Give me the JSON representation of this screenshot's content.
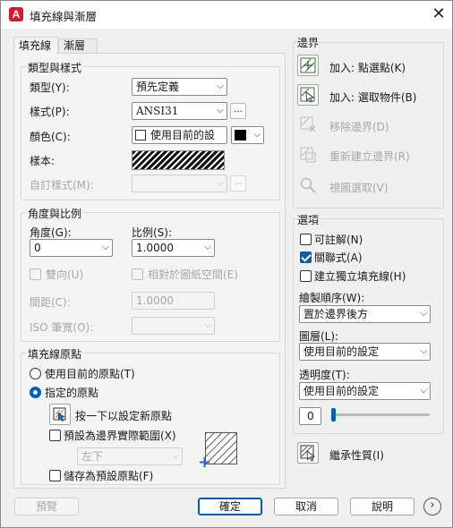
{
  "window": {
    "title": "填充線與漸層"
  },
  "tabs": [
    {
      "label": "填充線"
    },
    {
      "label": "漸層"
    }
  ],
  "type_pattern": {
    "group_title": "類型與樣式",
    "type_label": "類型(Y):",
    "type_value": "預先定義",
    "pattern_label": "樣式(P):",
    "pattern_value": "ANSI31",
    "color_label": "顏色(C):",
    "color_value": "使用目前的設",
    "swatch_label": "樣本:",
    "custom_label": "自訂樣式(M):",
    "ellipsis": "..."
  },
  "angle_scale": {
    "group_title": "角度與比例",
    "angle_label": "角度(G):",
    "angle_value": "0",
    "scale_label": "比例(S):",
    "scale_value": "1.0000",
    "double_label": "雙向(U)",
    "relative_label": "相對於圖紙空間(E)",
    "spacing_label": "間距(C):",
    "spacing_value": "1.0000",
    "iso_label": "ISO 筆寬(O):"
  },
  "origin": {
    "group_title": "填充線原點",
    "use_current": "使用目前的原點(T)",
    "specified": "指定的原點",
    "click_set": "按一下以設定新原點",
    "default_extents": "預設為邊界實際範圍(X)",
    "position_value": "左下",
    "store_default": "儲存為預設原點(F)"
  },
  "boundaries": {
    "title": "邊界",
    "add_pick": "加入: 點選點(K)",
    "add_select": "加入: 選取物件(B)",
    "remove": "移除邊界(D)",
    "recreate": "重新建立邊界(R)",
    "view": "視圖選取(V)"
  },
  "options": {
    "title": "選項",
    "annotative": "可註解(N)",
    "associative": "關聯式(A)",
    "separate": "建立獨立填充線(H)",
    "draw_order_label": "繪製順序(W):",
    "draw_order_value": "置於邊界後方",
    "layer_label": "圖層(L):",
    "layer_value": "使用目前的設定",
    "transparency_label": "透明度(T):",
    "transparency_value": "使用目前的設定",
    "transparency_number": "0",
    "transparency_level": 0
  },
  "inherit": "繼承性質(I)",
  "footer": {
    "preview": "預覽",
    "ok": "確定",
    "cancel": "取消",
    "help": "說明"
  },
  "colors": {
    "accent": "#005fb8",
    "app_icon": "#d21f2b"
  }
}
